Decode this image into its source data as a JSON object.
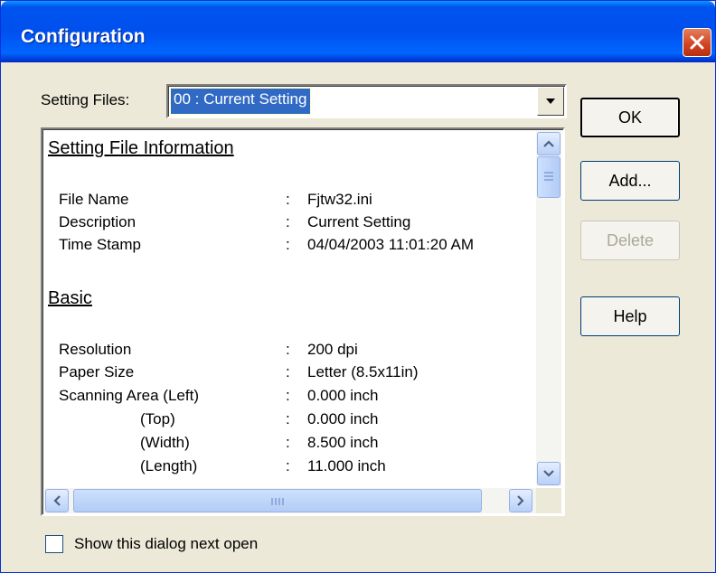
{
  "window": {
    "title": "Configuration",
    "colors": {
      "titlebar": "#0054e3",
      "face": "#ece9d8",
      "selection": "#316ac5",
      "close": "#d1421f"
    }
  },
  "setting_files": {
    "label": "Setting Files:",
    "selected": "00 : Current Setting"
  },
  "buttons": {
    "ok": "OK",
    "add": "Add...",
    "delete": "Delete",
    "help": "Help"
  },
  "info": {
    "file_section": {
      "heading": "Setting File Information",
      "rows": [
        {
          "key": "File Name",
          "value": "Fjtw32.ini"
        },
        {
          "key": "Description",
          "value": "Current Setting"
        },
        {
          "key": "Time Stamp",
          "value": "04/04/2003 11:01:20 AM"
        }
      ]
    },
    "basic_section": {
      "heading": "Basic",
      "rows": [
        {
          "key": "Resolution",
          "value": "200 dpi"
        },
        {
          "key": "Paper Size",
          "value": "Letter (8.5x11in)"
        },
        {
          "key": "Scanning Area (Left)",
          "value": "0.000 inch"
        },
        {
          "key": "(Top)",
          "value": "0.000 inch"
        },
        {
          "key": "(Width)",
          "value": "8.500 inch"
        },
        {
          "key": "(Length)",
          "value": "11.000 inch"
        }
      ]
    },
    "separator": ":"
  },
  "show_dialog": {
    "label": "Show this dialog next open",
    "checked": false
  },
  "icons": {
    "close": "close-icon",
    "dropdown": "chevron-down-icon",
    "scroll_up": "arrow-up-icon",
    "scroll_down": "arrow-down-icon",
    "scroll_left": "arrow-left-icon",
    "scroll_right": "arrow-right-icon"
  }
}
